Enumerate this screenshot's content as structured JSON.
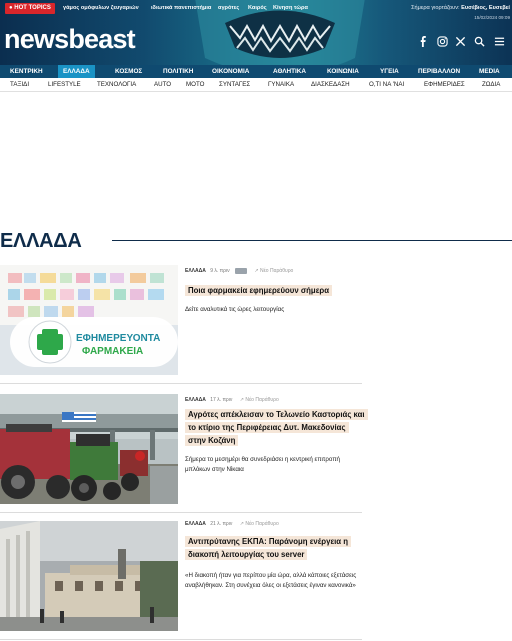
{
  "header": {
    "hot_topics_label": "HOT TOPICS",
    "topics": [
      "γάμος ομόφυλων ζευγαριών",
      "ιδιωτικά πανεπιστήμια",
      "αγρότες",
      "Καιρός",
      "Κίνηση τώρα"
    ],
    "today_label": "Σήμερα γιορτάζουν:",
    "today_names": "Ευσέβιος, Ευσεβεί",
    "datetime": "15/02/2024 09:09",
    "logo_text": "newsbeast",
    "social_icons": [
      "facebook-icon",
      "instagram-icon",
      "x-icon",
      "search-icon",
      "menu-icon"
    ]
  },
  "main_nav": [
    "ΚΕΝΤΡΙΚΗ",
    "ΕΛΛΑΔΑ",
    "ΚΟΣΜΟΣ",
    "ΠΟΛΙΤΙΚΗ",
    "ΟΙΚΟΝΟΜΙΑ",
    "ΑΘΛΗΤΙΚΑ",
    "ΚΟΙΝΩΝΙΑ",
    "ΥΓΕΙΑ",
    "ΠΕΡΙΒΑΛΛΟΝ",
    "MEDIA"
  ],
  "main_nav_active": "ΕΛΛΑΔΑ",
  "sub_nav": [
    "ΤΑΞΙΔΙ",
    "LIFESTYLE",
    "ΤΕΧΝΟΛΟΓΙΑ",
    "AUTO",
    "MOTO",
    "ΣΥΝΤΑΓΕΣ",
    "ΓΥΝΑΙΚΑ",
    "ΔΙΑΣΚΕΔΑΣΗ",
    "Ο,ΤΙ ΝΑ 'ΝΑΙ",
    "ΕΦΗΜΕΡΙΔΕΣ",
    "ΖΩΔΙΑ"
  ],
  "section": {
    "title": "ΕΛΛΑΔΑ"
  },
  "articles": [
    {
      "category": "ΕΛΛΑΔΑ",
      "time_ago": "9 λ. πριν",
      "save_label": "Νέο Παράθυρο",
      "title": "Ποια φαρμακεία εφημερεύουν σήμερα",
      "excerpt": "Δείτε αναλυτικά τις ώρες λειτουργίας",
      "image_text_1": "ΕΦΗΜΕΡΕΥΟΝΤΑ",
      "image_text_2": "ΦΑΡΜΑΚΕΙΑ"
    },
    {
      "category": "ΕΛΛΑΔΑ",
      "time_ago": "17 λ. πριν",
      "save_label": "Νέο Παράθυρο",
      "title": "Αγρότες απέκλεισαν το Τελωνείο Καστοριάς και το κτίριο της Περιφέρειας Δυτ. Μακεδονίας στην Κοζάνη",
      "excerpt": "Σήμερα το μεσημέρι θα συνεδριάσει η κεντρική επιτροπή μπλόκων στην Νίκαια"
    },
    {
      "category": "ΕΛΛΑΔΑ",
      "time_ago": "21 λ. πριν",
      "save_label": "Νέο Παράθυρο",
      "title": "Αντιπρύτανης ΕΚΠΑ: Παράνομη ενέργεια η διακοπή λειτουργίας του server",
      "excerpt": "«Η διακοπή ήταν για περίπου μία ώρα, αλλά κάποιες εξετάσεις αναβλήθηκαν. Στη συνέχεια όλες οι εξετάσεις έγιναν κανονικά»"
    }
  ]
}
